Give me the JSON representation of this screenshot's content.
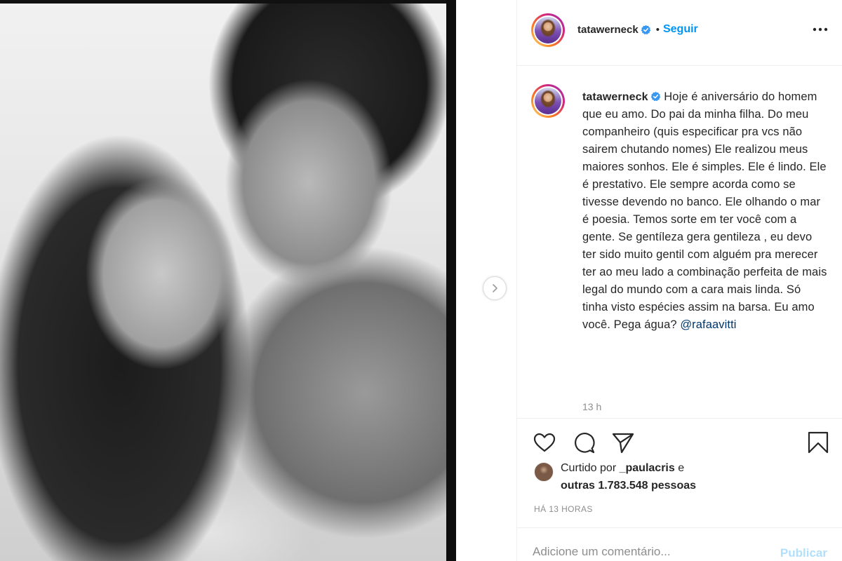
{
  "post": {
    "username": "tatawerneck",
    "follow_label": "Seguir",
    "dot_separator": "•",
    "caption": "Hoje é aniversário do homem que eu amo. Do pai da minha filha. Do meu companheiro (quis especificar pra vcs não sairem chutando nomes) Ele realizou meus maiores sonhos. Ele é simples. Ele é lindo. Ele é prestativo. Ele sempre acorda como se tivesse devendo no banco. Ele olhando o mar é poesia. Temos sorte em ter você com a gente. Se gentíleza gera gentileza , eu devo ter sido muito gentil com alguém pra merecer ter ao meu lado a combinação perfeita de mais legal do mundo com a cara mais linda. Só tinha visto espécies assim na barsa. Eu amo você. Pega água?",
    "mention": "@rafaavitti",
    "caption_time": "13 h",
    "liked_by_prefix": "Curtido por",
    "liked_by_user": "_paulacris",
    "liked_by_conj": "e",
    "liked_by_others": "outras 1.783.548 pessoas",
    "post_date": "HÁ 13 HORAS"
  },
  "comment": {
    "placeholder": "Adicione um comentário...",
    "publish_label": "Publicar"
  },
  "icons": {
    "verified": "verified-badge-icon",
    "more": "more-options-icon",
    "next": "chevron-right-icon",
    "like": "heart-icon",
    "comment": "comment-bubble-icon",
    "share": "paper-plane-icon",
    "save": "bookmark-icon"
  },
  "colors": {
    "link_blue": "#0095f6",
    "publish_disabled": "#b2dffc",
    "muted_text": "#8e8e8e",
    "text": "#262626",
    "mention": "#00376b",
    "divider": "#efefef"
  }
}
